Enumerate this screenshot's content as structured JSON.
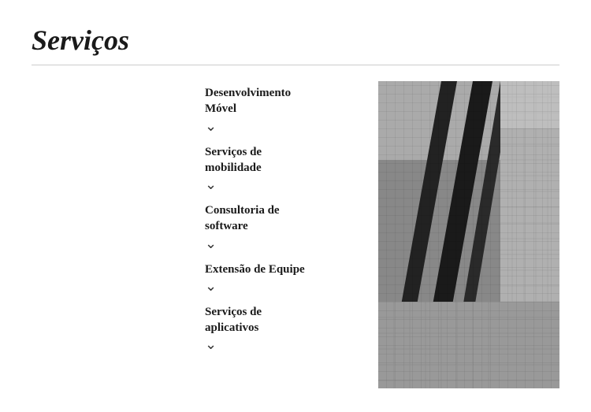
{
  "page": {
    "title": "Serviços"
  },
  "services": [
    {
      "id": "desenvolvimento-movel",
      "label": "Desenvolvimento\nMóvel"
    },
    {
      "id": "servicos-mobilidade",
      "label": "Serviços de\nmobilidade"
    },
    {
      "id": "consultoria-software",
      "label": "Consultoria de\nsoftware"
    },
    {
      "id": "extensao-equipe",
      "label": "Extensão de Equipe"
    },
    {
      "id": "servicos-aplicativos",
      "label": "Serviços de\naplicativos"
    }
  ],
  "chevron_symbol": "⌄",
  "colors": {
    "title": "#1a1a1a",
    "text": "#1a1a1a",
    "divider": "#cccccc"
  }
}
